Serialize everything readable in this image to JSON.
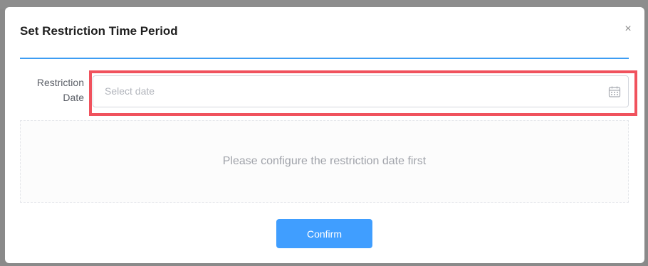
{
  "dialog": {
    "title": "Set Restriction Time Period",
    "close_glyph": "×",
    "close_icon": "close-icon"
  },
  "form": {
    "label": "Restriction Date",
    "date_input": {
      "value": "",
      "placeholder": "Select date",
      "icon": "calendar-icon"
    },
    "empty_message": "Please configure the restriction date first"
  },
  "footer": {
    "confirm_label": "Confirm"
  },
  "colors": {
    "accent": "#409eff",
    "divider": "#3d9df3",
    "highlight": "#f0525d"
  }
}
